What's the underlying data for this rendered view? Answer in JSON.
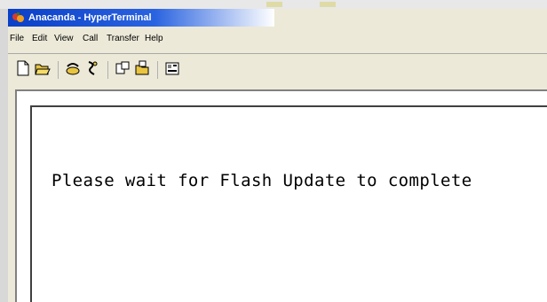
{
  "window": {
    "title": "Anacanda - HyperTerminal",
    "app_icon": "hyperterminal-icon"
  },
  "menu": {
    "items": [
      "File",
      "Edit",
      "View",
      "Call",
      "Transfer",
      "Help"
    ]
  },
  "toolbar": {
    "buttons": [
      {
        "name": "new-connection-icon"
      },
      {
        "name": "open-icon"
      },
      {
        "name": "connect-icon"
      },
      {
        "name": "disconnect-icon"
      },
      {
        "name": "send-icon"
      },
      {
        "name": "receive-icon"
      },
      {
        "name": "properties-icon"
      }
    ]
  },
  "terminal": {
    "text": "Please wait for Flash Update to complete"
  },
  "colors": {
    "titlebar": "#0a3fc7",
    "chrome": "#ece9d8",
    "terminal_bg": "#ffffff"
  }
}
